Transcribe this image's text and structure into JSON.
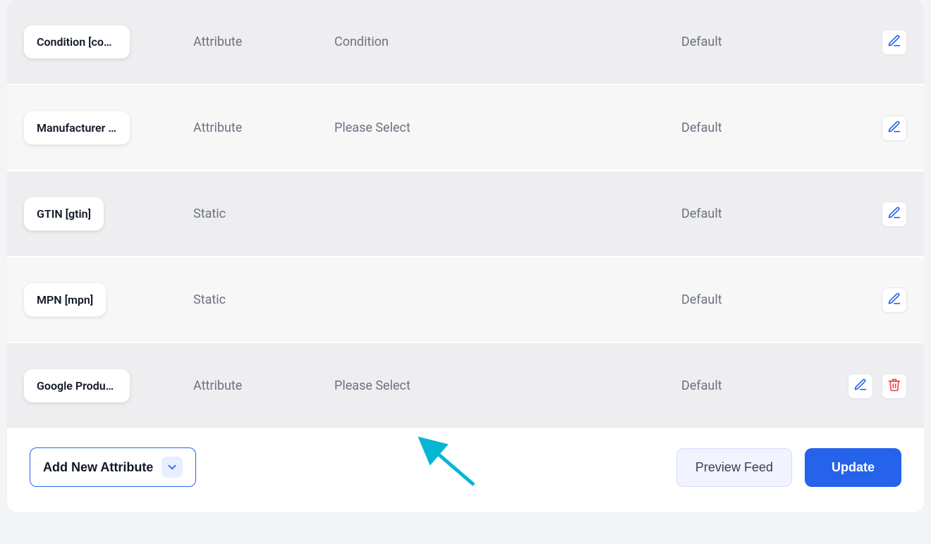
{
  "rows": [
    {
      "label": "Condition [condition]",
      "type": "Attribute",
      "value": "Condition",
      "output": "Default",
      "deletable": false
    },
    {
      "label": "Manufacturer [manufacturer]",
      "type": "Attribute",
      "value": "Please Select",
      "output": "Default",
      "deletable": false
    },
    {
      "label": "GTIN [gtin]",
      "type": "Static",
      "value": "",
      "output": "Default",
      "deletable": false
    },
    {
      "label": "MPN [mpn]",
      "type": "Static",
      "value": "",
      "output": "Default",
      "deletable": false
    },
    {
      "label": "Google Product Category",
      "type": "Attribute",
      "value": "Please Select",
      "output": "Default",
      "deletable": true
    }
  ],
  "footer": {
    "add_label": "Add New Attribute",
    "preview_label": "Preview Feed",
    "update_label": "Update"
  },
  "colors": {
    "accent": "#2563eb",
    "danger": "#ef4444"
  }
}
